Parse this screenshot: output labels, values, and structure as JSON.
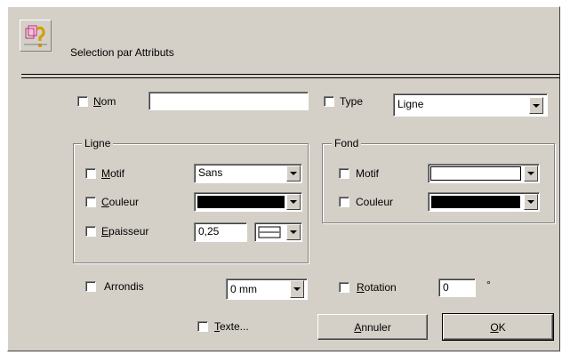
{
  "dialog": {
    "title": "Selection par Attributs",
    "icon": "query-icon"
  },
  "nom": {
    "label_u": "N",
    "label_rest": "om",
    "value": "",
    "checked": false
  },
  "type": {
    "label": "Type",
    "value": "Ligne",
    "checked": false
  },
  "ligne": {
    "title": "Ligne",
    "motif": {
      "label_u": "M",
      "label_rest": "otif",
      "value": "Sans",
      "checked": false
    },
    "couleur": {
      "label_u": "C",
      "label_rest": "ouleur",
      "color": "#000000",
      "checked": false
    },
    "epaisseur": {
      "label_u": "E",
      "label_rest": "paisseur",
      "value": "0,25",
      "checked": false,
      "style_icon": "line-style-icon"
    }
  },
  "fond": {
    "title": "Fond",
    "motif": {
      "label": "Motif",
      "color": "#ffffff",
      "checked": false
    },
    "couleur": {
      "label": "Couleur",
      "color": "#000000",
      "checked": false
    }
  },
  "arrondis": {
    "label": "Arrondis",
    "value": "0 mm",
    "checked": false
  },
  "rotation": {
    "label_u": "R",
    "label_rest": "otation",
    "value": "0",
    "unit": "°",
    "checked": false
  },
  "texte": {
    "label_u": "T",
    "label_rest": "exte...",
    "checked": false
  },
  "buttons": {
    "cancel": {
      "label_u": "A",
      "label_rest": "nnuler"
    },
    "ok": {
      "label_u": "O",
      "label_rest": "K"
    }
  }
}
